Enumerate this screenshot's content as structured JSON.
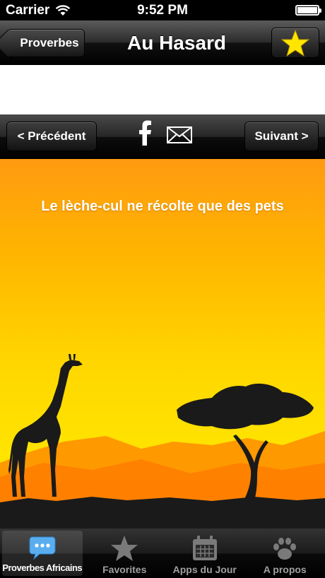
{
  "status_bar": {
    "carrier": "Carrier",
    "time": "9:52 PM"
  },
  "nav_bar": {
    "back_label": "Proverbes",
    "title": "Au Hasard",
    "favorite_icon": "star-icon"
  },
  "toolbar": {
    "prev_label": "< Précédent",
    "next_label": "Suivant >",
    "share_icons": [
      "facebook-icon",
      "mail-icon"
    ]
  },
  "proverb": {
    "text": "Le lèche-cul ne récolte que des pets"
  },
  "tabs": [
    {
      "label": "Proverbes Africains",
      "icon": "speech-bubble-icon",
      "active": true
    },
    {
      "label": "Favorites",
      "icon": "star-icon",
      "active": false
    },
    {
      "label": "Apps du Jour",
      "icon": "calendar-icon",
      "active": false
    },
    {
      "label": "A propos",
      "icon": "paw-icon",
      "active": false
    }
  ],
  "colors": {
    "sky_top": "#ff9a10",
    "sky_bottom": "#ffe400",
    "accent_star": "#ffe600",
    "active_tab_icon": "#5aaef0"
  }
}
